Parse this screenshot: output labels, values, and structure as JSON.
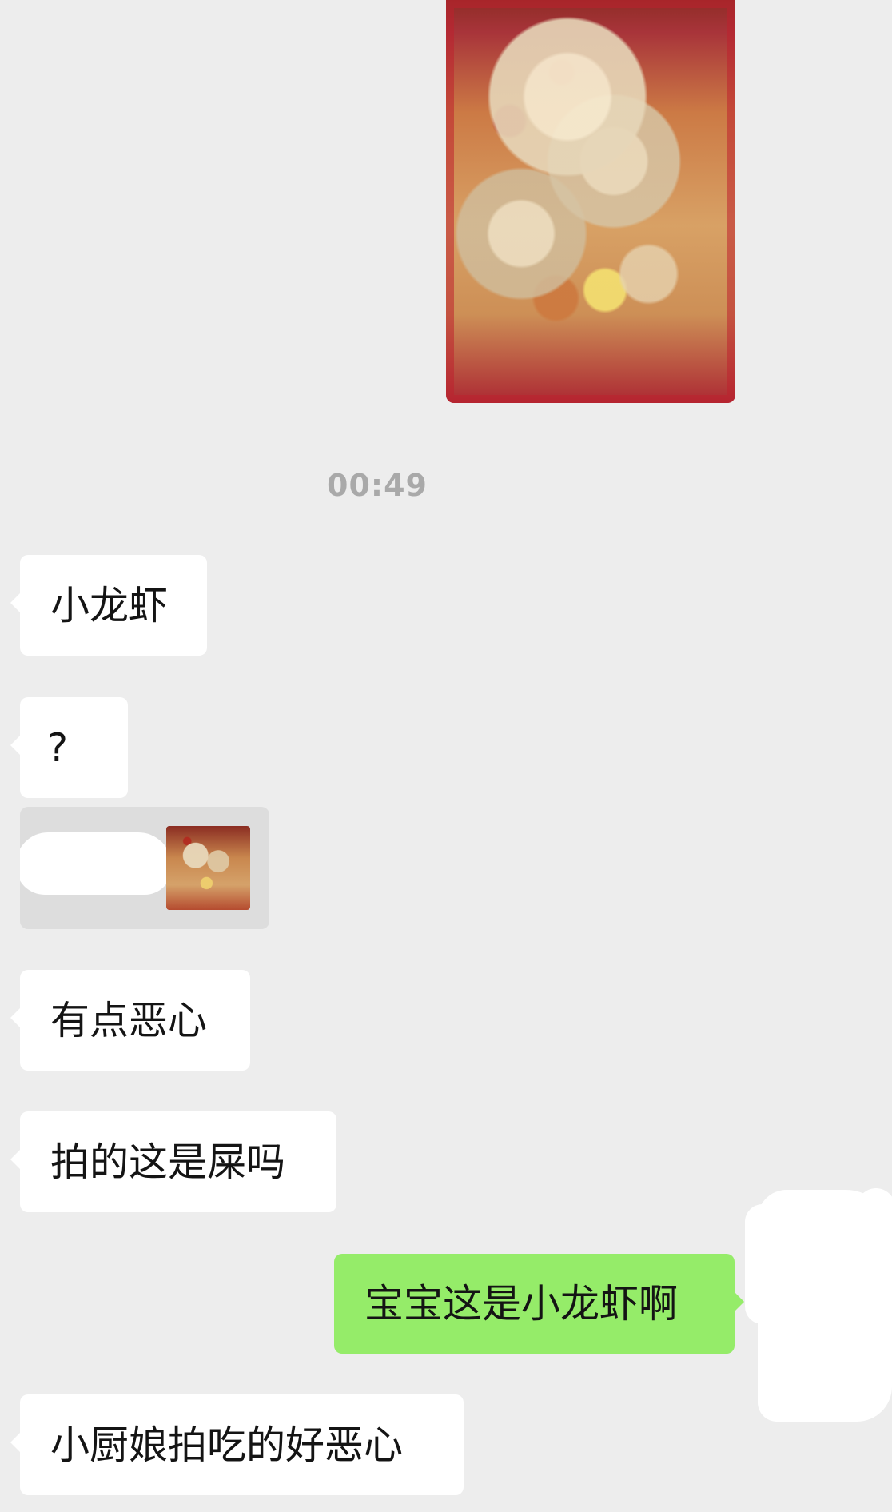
{
  "chat": {
    "time_label": "00:49",
    "messages": [
      {
        "text": "小龙虾"
      },
      {
        "text": "?"
      },
      {
        "text": "有点恶心"
      },
      {
        "text": "拍的这是屎吗"
      },
      {
        "text": "宝宝这是小龙虾啊"
      },
      {
        "text": "小厨娘拍吃的好恶心"
      }
    ]
  },
  "colors": {
    "background": "#ededed",
    "incoming_bubble": "#ffffff",
    "outgoing_bubble": "#95ec69",
    "timestamp": "#a9a9a9"
  }
}
